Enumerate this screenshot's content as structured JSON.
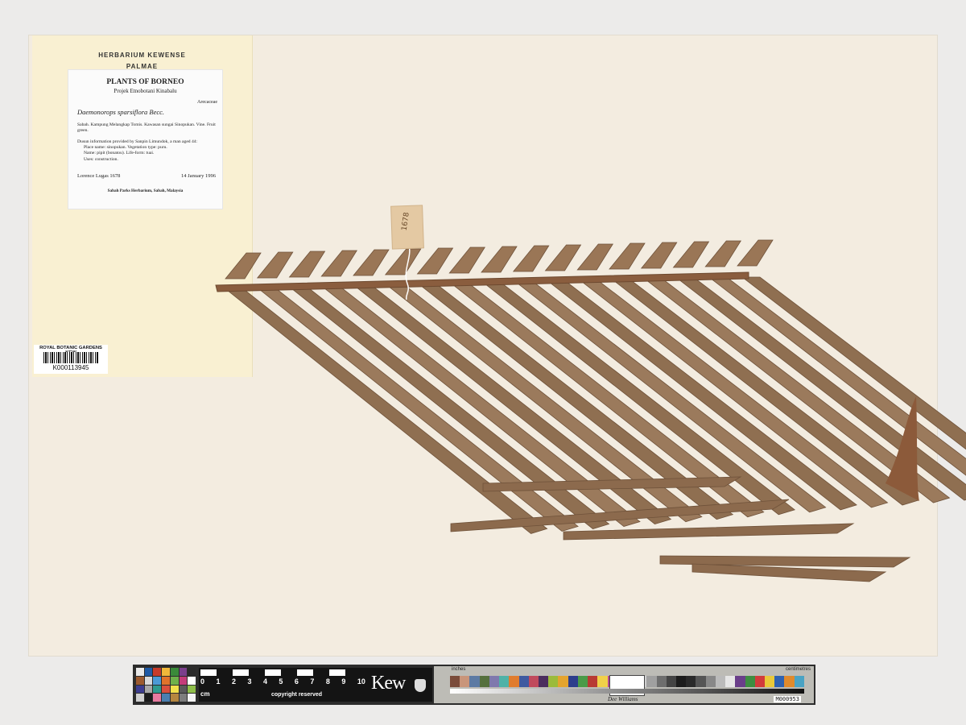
{
  "herbarium": {
    "line1": "HERBARIUM KEWENSE",
    "line2": "PALMAE"
  },
  "label": {
    "title": "PLANTS OF BORNEO",
    "subtitle": "Projek Etnobotani Kinabalu",
    "family": "Arecaceae",
    "species": "Daemonorops sparsiflora Becc.",
    "locality": "Sabah. Kampung Melangkap Tomis. Kawasan sungai Sinopukan. Vine. Fruit green.",
    "dusun_lines": [
      "Dusun information provided by Sanpin Limundok, a man aged 44:",
      "Place name: sinopukan. Vegetation type: puru.",
      "Name: pipit (bonatou). Life-form: tuai.",
      "Uses: construction."
    ],
    "collector": "Lorence Lugas 1678",
    "date": "14 January 1996",
    "institution": "Sabah Parks Herbarium, Sabah, Malaysia"
  },
  "barcode": {
    "title": "ROYAL BOTANIC GARDENS KEW",
    "number": "K000113945"
  },
  "tag": {
    "text": "1678"
  },
  "scale_bar": {
    "numbers": [
      "0",
      "1",
      "2",
      "3",
      "4",
      "5",
      "6",
      "7",
      "8",
      "9",
      "10"
    ],
    "unit": "cm",
    "copyright": "copyright reserved",
    "logo": "Kew",
    "card_inches": "inches",
    "card_cm": "centimetres",
    "signature": "Dee Williams",
    "card_id": "M000953",
    "swatch_colors": [
      "#e9e9e9",
      "#1f5aa6",
      "#c63b2a",
      "#f0b83a",
      "#3a8a3a",
      "#7b3f8c",
      "#2a2a2a",
      "#9c5a2f",
      "#d9d9d9",
      "#4b9ad6",
      "#e0732b",
      "#6fb04a",
      "#c43c7a",
      "#ffffff",
      "#3d3d8f",
      "#a8a8a8",
      "#2e9a8f",
      "#d94f3d",
      "#f2e04b",
      "#5a5a5a",
      "#8fbf4a",
      "#cfcfcf",
      "#1b1b1b",
      "#e87aa0",
      "#4a7fb0",
      "#b5863f",
      "#7d7d7d",
      "#f4f4f4"
    ],
    "patch_colors": [
      "#7a4b3a",
      "#c9957a",
      "#5c7aa3",
      "#55703d",
      "#7f79ad",
      "#4fb2a7",
      "#e07c2e",
      "#3f5aa0",
      "#c04a5c",
      "#4c2e5e",
      "#9bbb3b",
      "#e4a42e",
      "#2d3e8c",
      "#4a9b48",
      "#b83a34",
      "#f0d04a",
      "#b64b92",
      "#1b8fb0",
      "#ffffff",
      "#cfcfcf",
      "#a0a0a0",
      "#6e6e6e",
      "#444444",
      "#1c1c1c",
      "#2a2a2a",
      "#555555",
      "#888888",
      "#bbbbbb",
      "#e6e6e6",
      "#6a3f8a",
      "#3e8e41",
      "#d23c3c",
      "#e9c93a",
      "#2f62b0",
      "#e08a2c",
      "#4aa3c4"
    ]
  }
}
